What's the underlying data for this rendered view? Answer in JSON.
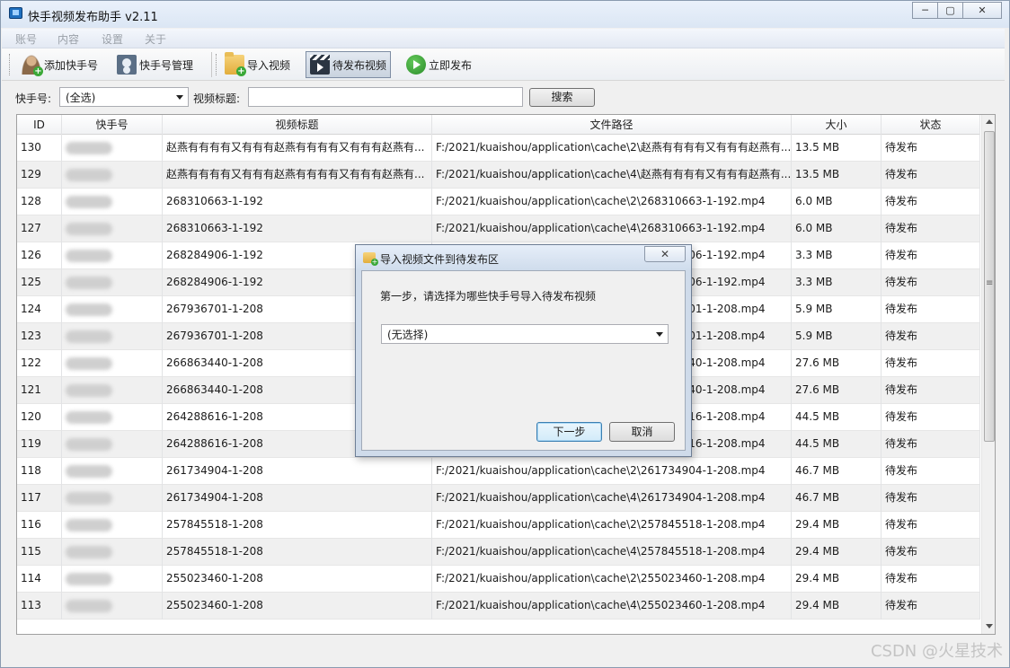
{
  "window": {
    "title": "快手视频发布助手 v2.11",
    "controls": {
      "minimize": "─",
      "maximize": "▢",
      "close": "✕"
    }
  },
  "menu": [
    "账号",
    "内容",
    "设置",
    "关于"
  ],
  "toolbar": {
    "add_account": "添加快手号",
    "manage_account": "快手号管理",
    "import_video": "导入视频",
    "pending_video": "待发布视频",
    "publish_now": "立即发布"
  },
  "filter": {
    "account_label": "快手号:",
    "account_value": "(全选)",
    "title_label": "视频标题:",
    "title_value": "",
    "search_button": "搜索"
  },
  "table": {
    "columns": [
      "ID",
      "快手号",
      "视频标题",
      "文件路径",
      "大小",
      "状态"
    ],
    "rows": [
      {
        "id": "130",
        "title": "赵燕有有有有又有有有赵燕有有有有又有有有赵燕有...",
        "path": "F:/2021/kuaishou/application\\cache\\2\\赵燕有有有有又有有有赵燕有...",
        "size": "13.5 MB",
        "status": "待发布"
      },
      {
        "id": "129",
        "title": "赵燕有有有有又有有有赵燕有有有有又有有有赵燕有...",
        "path": "F:/2021/kuaishou/application\\cache\\4\\赵燕有有有有又有有有赵燕有...",
        "size": "13.5 MB",
        "status": "待发布"
      },
      {
        "id": "128",
        "title": "268310663-1-192",
        "path": "F:/2021/kuaishou/application\\cache\\2\\268310663-1-192.mp4",
        "size": "6.0 MB",
        "status": "待发布"
      },
      {
        "id": "127",
        "title": "268310663-1-192",
        "path": "F:/2021/kuaishou/application\\cache\\4\\268310663-1-192.mp4",
        "size": "6.0 MB",
        "status": "待发布"
      },
      {
        "id": "126",
        "title": "268284906-1-192",
        "path": "F:/2021/kuaishou/application\\cache\\2\\268284906-1-192.mp4",
        "size": "3.3 MB",
        "status": "待发布"
      },
      {
        "id": "125",
        "title": "268284906-1-192",
        "path": "F:/2021/kuaishou/application\\cache\\4\\268284906-1-192.mp4",
        "size": "3.3 MB",
        "status": "待发布"
      },
      {
        "id": "124",
        "title": "267936701-1-208",
        "path": "F:/2021/kuaishou/application\\cache\\2\\267936701-1-208.mp4",
        "size": "5.9 MB",
        "status": "待发布"
      },
      {
        "id": "123",
        "title": "267936701-1-208",
        "path": "F:/2021/kuaishou/application\\cache\\4\\267936701-1-208.mp4",
        "size": "5.9 MB",
        "status": "待发布"
      },
      {
        "id": "122",
        "title": "266863440-1-208",
        "path": "F:/2021/kuaishou/application\\cache\\2\\266863440-1-208.mp4",
        "size": "27.6 MB",
        "status": "待发布"
      },
      {
        "id": "121",
        "title": "266863440-1-208",
        "path": "F:/2021/kuaishou/application\\cache\\4\\266863440-1-208.mp4",
        "size": "27.6 MB",
        "status": "待发布"
      },
      {
        "id": "120",
        "title": "264288616-1-208",
        "path": "F:/2021/kuaishou/application\\cache\\2\\264288616-1-208.mp4",
        "size": "44.5 MB",
        "status": "待发布"
      },
      {
        "id": "119",
        "title": "264288616-1-208",
        "path": "F:/2021/kuaishou/application\\cache\\4\\264288616-1-208.mp4",
        "size": "44.5 MB",
        "status": "待发布"
      },
      {
        "id": "118",
        "title": "261734904-1-208",
        "path": "F:/2021/kuaishou/application\\cache\\2\\261734904-1-208.mp4",
        "size": "46.7 MB",
        "status": "待发布"
      },
      {
        "id": "117",
        "title": "261734904-1-208",
        "path": "F:/2021/kuaishou/application\\cache\\4\\261734904-1-208.mp4",
        "size": "46.7 MB",
        "status": "待发布"
      },
      {
        "id": "116",
        "title": "257845518-1-208",
        "path": "F:/2021/kuaishou/application\\cache\\2\\257845518-1-208.mp4",
        "size": "29.4 MB",
        "status": "待发布"
      },
      {
        "id": "115",
        "title": "257845518-1-208",
        "path": "F:/2021/kuaishou/application\\cache\\4\\257845518-1-208.mp4",
        "size": "29.4 MB",
        "status": "待发布"
      },
      {
        "id": "114",
        "title": "255023460-1-208",
        "path": "F:/2021/kuaishou/application\\cache\\2\\255023460-1-208.mp4",
        "size": "29.4 MB",
        "status": "待发布"
      },
      {
        "id": "113",
        "title": "255023460-1-208",
        "path": "F:/2021/kuaishou/application\\cache\\4\\255023460-1-208.mp4",
        "size": "29.4 MB",
        "status": "待发布"
      }
    ]
  },
  "dialog": {
    "title": "导入视频文件到待发布区",
    "close": "✕",
    "prompt": "第一步，请选择为哪些快手号导入待发布视频",
    "select_value": "(无选择)",
    "next_button": "下一步",
    "cancel_button": "取消"
  },
  "watermark": "CSDN @火星技术"
}
